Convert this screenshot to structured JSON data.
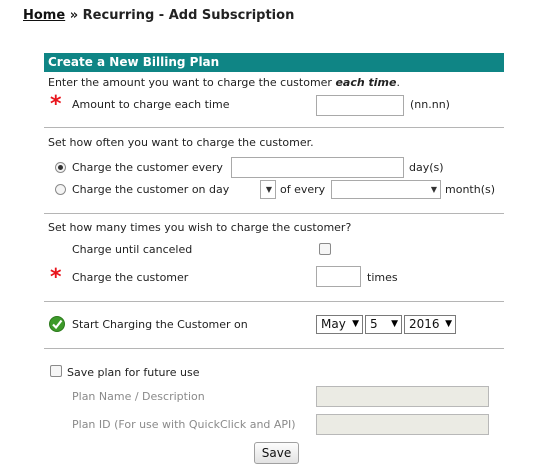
{
  "breadcrumb": {
    "home": "Home",
    "sep": "»",
    "current": "Recurring - Add Subscription"
  },
  "plan": {
    "title": "Create a New Billing Plan",
    "intro_prefix": "Enter the amount you want to charge the customer",
    "intro_emph": "each time",
    "intro_suffix": ".",
    "amount_label": "Amount to charge each time",
    "amount_value": "",
    "amount_hint": "(nn.nn)"
  },
  "frequency": {
    "intro": "Set how often you want to charge the customer.",
    "every_label": "Charge the customer every",
    "every_value": "",
    "every_unit": "day(s)",
    "onday_label": "Charge the customer on day",
    "onday_value": "",
    "of_every": "of every",
    "months_value": "",
    "month_unit": "month(s)"
  },
  "times": {
    "intro": "Set how many times you wish to charge the customer?",
    "until_canceled_label": "Charge until canceled",
    "charge_label": "Charge the customer",
    "charge_value": "",
    "times_unit": "times"
  },
  "start": {
    "label": "Start Charging the Customer on",
    "month": "May",
    "day": "5",
    "year": "2016"
  },
  "save_plan": {
    "label": "Save plan for future use",
    "name_label": "Plan Name / Description",
    "id_label": "Plan ID (For use with QuickClick and API)",
    "name_value": "",
    "id_value": ""
  },
  "save_button": "Save",
  "colors": {
    "header": "#0f8585",
    "required": "#e8141c",
    "check": "#3d9a2a"
  }
}
